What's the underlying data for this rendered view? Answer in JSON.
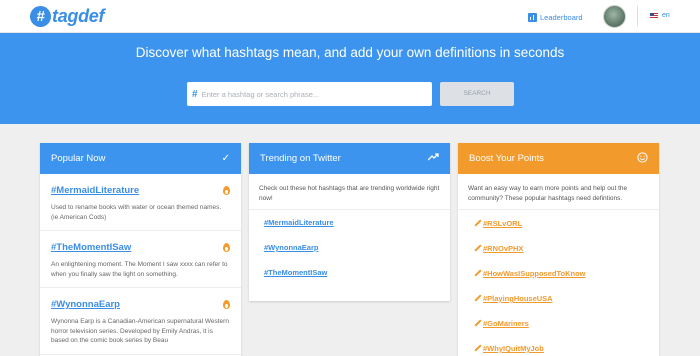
{
  "nav": {
    "logo_mark": "#",
    "logo_text": "tagdef",
    "leaderboard_label": "Leaderboard",
    "leaderboard_icon": "bar-chart-icon",
    "language": "en",
    "flag_icon": "us-flag-icon"
  },
  "hero": {
    "title": "Discover what hashtags mean, and add your own definitions in seconds",
    "search_icon": "#",
    "search_placeholder": "Enter a hashtag or search phrase...",
    "search_value": "",
    "search_button": "SEARCH"
  },
  "popular": {
    "title": "Popular Now",
    "header_icon": "check-icon",
    "items": [
      {
        "tag": "#MermaidLiterature",
        "description": "Used to rename books with water or ocean themed names. (ie American Cods)"
      },
      {
        "tag": "#TheMomentISaw",
        "description": "An enlightening moment. The Moment I saw xxxx can refer to when you finally saw the light on something."
      },
      {
        "tag": "#WynonnaEarp",
        "description": "Wynonna Earp is a Canadian-American supernatural Western horror television series. Developed by Emily Andras, it is based on the comic book series by Beau"
      }
    ]
  },
  "trending": {
    "title": "Trending on Twitter",
    "header_icon": "trending-up-icon",
    "intro": "Check out these hot hashtags that are trending worldwide right now!",
    "items": [
      "#MermaidLiterature",
      "#WynonnaEarp",
      "#TheMomentISaw"
    ]
  },
  "boost": {
    "title": "Boost Your Points",
    "header_icon": "smiley-icon",
    "intro": "Want an easy way to earn more points and help out the community? These popular hashtags need defintions.",
    "items": [
      "#RSLvORL",
      "#RNOvPHX",
      "#HowWasISupposedToKnow",
      "#PlayingHouseUSA",
      "#GoMariners",
      "#WhyIQuitMyJob"
    ]
  },
  "colors": {
    "brand_blue": "#3d94ee",
    "accent_orange": "#f39a2d"
  }
}
